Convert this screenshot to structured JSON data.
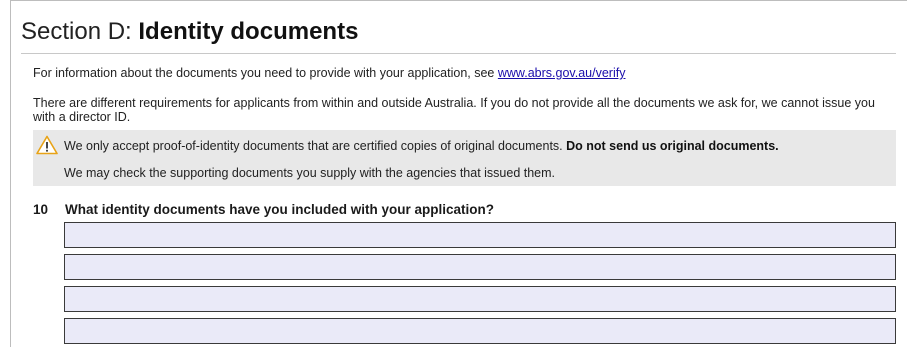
{
  "section": {
    "prefix": "Section D: ",
    "title": "Identity documents"
  },
  "info": {
    "line1_text": "For information about the documents you need to provide with your application, see ",
    "line1_link": "www.abrs.gov.au/verify",
    "line2": "There are different requirements for applicants from within and outside Australia. If you do not provide all the documents we ask for, we cannot issue you with a director ID."
  },
  "notice": {
    "line1_text": "We only accept proof-of-identity documents that are certified copies of original documents. ",
    "line1_bold": "Do not send us original documents.",
    "line2": "We may check the supporting documents you supply with the agencies that issued them.",
    "icon": "warning-icon",
    "icon_color": "#e8a317",
    "background": "#e8e8e8"
  },
  "question": {
    "number": "10",
    "text": "What identity documents have you included with your application?"
  },
  "fields": [
    {
      "value": ""
    },
    {
      "value": ""
    },
    {
      "value": ""
    },
    {
      "value": ""
    }
  ],
  "colors": {
    "field_background": "#eaeaf8",
    "link": "#1a0dab"
  }
}
